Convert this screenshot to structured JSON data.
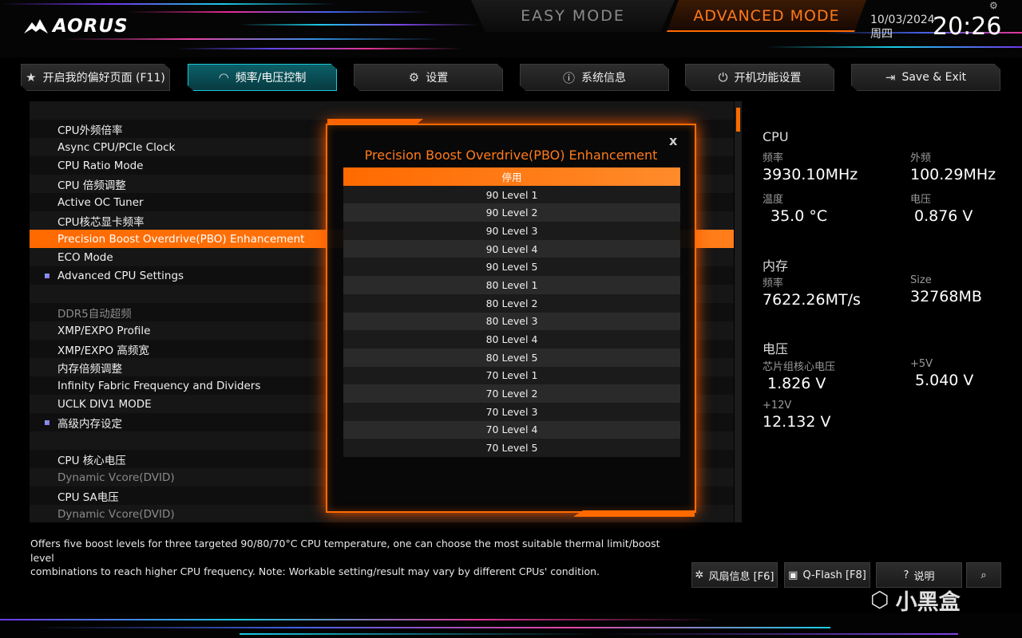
{
  "header": {
    "brand": "AORUS",
    "easy_mode": "EASY MODE",
    "advanced_mode": "ADVANCED MODE",
    "date": "10/03/2024",
    "weekday": "周四",
    "time": "20:26"
  },
  "tabs": [
    {
      "label": "开启我的偏好页面 (F11)",
      "icon": "favorite-icon"
    },
    {
      "label": "频率/电压控制",
      "icon": "gauge-icon"
    },
    {
      "label": "设置",
      "icon": "gear-icon"
    },
    {
      "label": "系统信息",
      "icon": "info-icon"
    },
    {
      "label": "开机功能设置",
      "icon": "power-icon"
    },
    {
      "label": "Save & Exit",
      "icon": "exit-icon"
    }
  ],
  "list": [
    {
      "label": ""
    },
    {
      "label": "CPU外频倍率"
    },
    {
      "label": "Async CPU/PCIe Clock"
    },
    {
      "label": "CPU Ratio Mode"
    },
    {
      "label": "CPU 倍频调整"
    },
    {
      "label": "Active OC Tuner"
    },
    {
      "label": "CPU核芯显卡频率"
    },
    {
      "label": "Precision Boost Overdrive(PBO) Enhancement"
    },
    {
      "label": "ECO Mode"
    },
    {
      "label": "Advanced CPU Settings"
    },
    {
      "label": ""
    },
    {
      "label": "DDR5自动超频"
    },
    {
      "label": "XMP/EXPO Profile"
    },
    {
      "label": "XMP/EXPO 高频宽"
    },
    {
      "label": "内存倍频调整"
    },
    {
      "label": "Infinity Fabric Frequency and Dividers"
    },
    {
      "label": "UCLK DIV1 MODE"
    },
    {
      "label": "高级内存设定"
    },
    {
      "label": ""
    },
    {
      "label": "CPU 核心电压"
    },
    {
      "label": "Dynamic Vcore(DVID)"
    },
    {
      "label": "CPU SA电压"
    },
    {
      "label": "Dynamic Vcore(DVID)"
    }
  ],
  "popup": {
    "title": "Precision Boost Overdrive(PBO) Enhancement",
    "close": "x",
    "options": [
      "停用",
      "90 Level 1",
      "90 Level 2",
      "90 Level 3",
      "90 Level 4",
      "90 Level 5",
      "80 Level 1",
      "80 Level 2",
      "80 Level 3",
      "80 Level 4",
      "80 Level 5",
      "70 Level 1",
      "70 Level 2",
      "70 Level 3",
      "70 Level 4",
      "70 Level 5"
    ],
    "selected_index": 0
  },
  "monitor": {
    "cpu_title": "CPU",
    "freq_label": "频率",
    "freq_value": "3930.10MHz",
    "bclk_label": "外频",
    "bclk_value": "100.29MHz",
    "temp_label": "温度",
    "temp_value": "35.0 °C",
    "volt_label": "电压",
    "volt_value": "0.876 V",
    "mem_title": "内存",
    "mem_freq_label": "频率",
    "mem_freq_value": "7622.26MT/s",
    "size_label": "Size",
    "size_value": "32768MB",
    "volt_title": "电压",
    "chipset_label": "芯片组核心电压",
    "chipset_value": "1.826 V",
    "v5_label": "+5V",
    "v5_value": "5.040 V",
    "v12_label": "+12V",
    "v12_value": "12.132 V"
  },
  "help": {
    "line1": "Offers five boost levels for three targeted 90/80/70°C CPU temperature, one can choose the most suitable thermal limit/boost level",
    "line2": "combinations to reach higher CPU frequency. Note: Workable setting/result may vary by different CPUs' condition."
  },
  "bottom": {
    "fan": "风扇信息 [F6]",
    "qflash": "Q-Flash [F8]",
    "help": "说明"
  },
  "watermark": "小黑盒",
  "colors": {
    "accent": "#ff6a00",
    "teal": "#1ccad8"
  }
}
